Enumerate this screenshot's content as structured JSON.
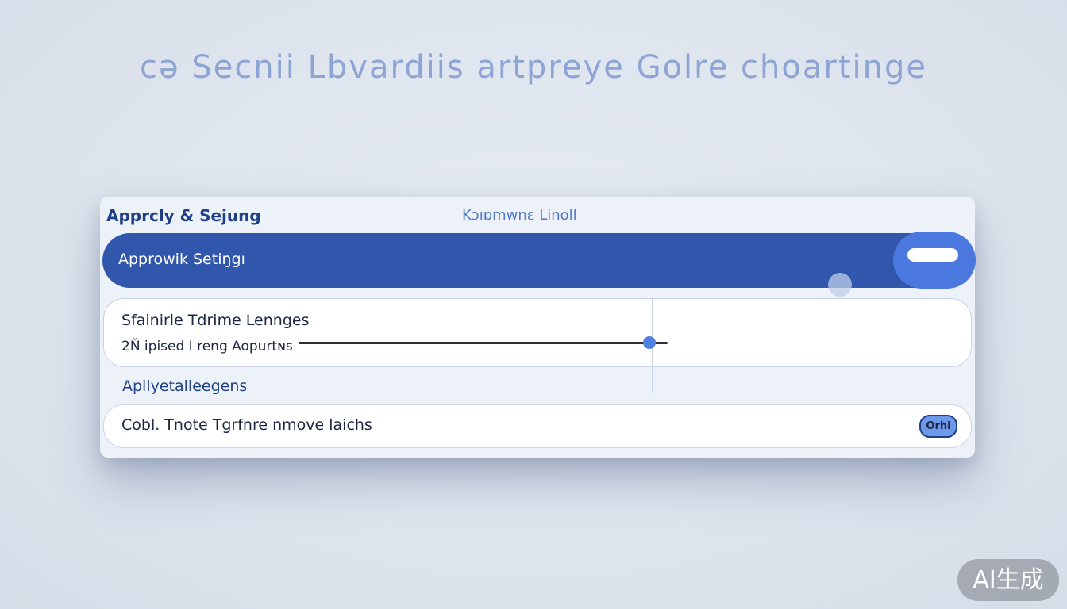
{
  "hero": {
    "title": "cə Secnii Lbvardiis artpreye Golre choartinge"
  },
  "panel": {
    "title": "Apprcly & Sejung",
    "subtitle": "Kɔıɒmwnɛ Linoll",
    "banner": {
      "label": "Approwik Setiŋgı",
      "toggle_on": true
    },
    "card1": {
      "row1_label": "Sfainirle Tdrime Lennges",
      "row2_label": "2Ň ipised I reng Aopurtɴs",
      "slider_value": 0.95
    },
    "section_heading": "Apllyetalleegens",
    "card2": {
      "row_label": "Cobl. Tnote Tgrfnre nmove laichs",
      "toggle_label": "Orhl"
    }
  },
  "watermark": "AI生成",
  "colors": {
    "accent": "#3157ad",
    "toggle": "#4a78de",
    "slider_thumb": "#4f7fe0",
    "background": "#e2e8f1"
  }
}
